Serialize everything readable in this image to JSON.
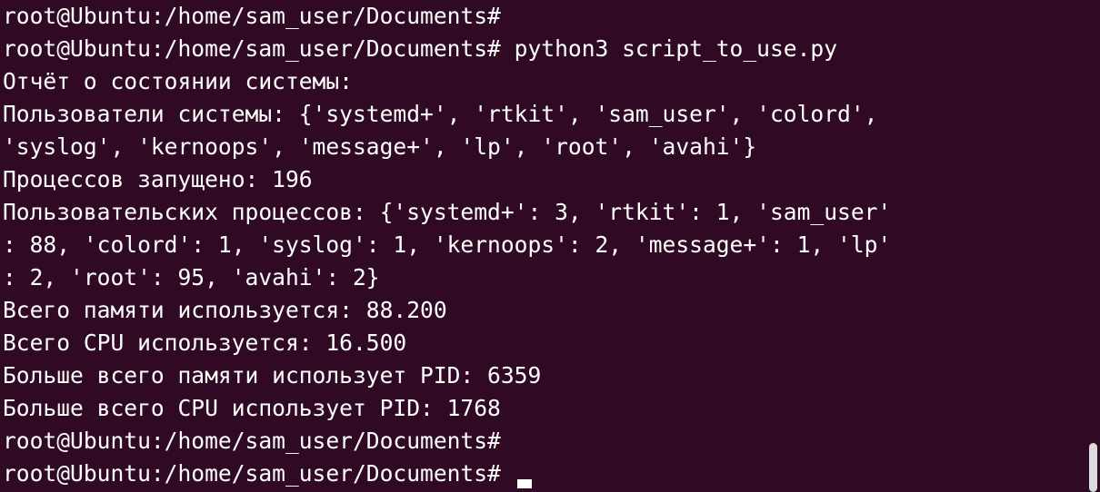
{
  "terminal": {
    "lines": [
      {
        "type": "prompt",
        "text": "root@Ubuntu:/home/sam_user/Documents#"
      },
      {
        "type": "prompt",
        "text": "root@Ubuntu:/home/sam_user/Documents# python3 script_to_use.py"
      },
      {
        "type": "output",
        "text": "Отчёт о состоянии системы:"
      },
      {
        "type": "output",
        "text": "Пользователи системы: {'systemd+', 'rtkit', 'sam_user', 'colord',"
      },
      {
        "type": "output",
        "text": "'syslog', 'kernoops', 'message+', 'lp', 'root', 'avahi'}"
      },
      {
        "type": "output",
        "text": "Процессов запущено: 196"
      },
      {
        "type": "output",
        "text": "Пользовательских процессов: {'systemd+': 3, 'rtkit': 1, 'sam_user'"
      },
      {
        "type": "output",
        "text": ": 88, 'colord': 1, 'syslog': 1, 'kernoops': 2, 'message+': 1, 'lp'"
      },
      {
        "type": "output",
        "text": ": 2, 'root': 95, 'avahi': 2}"
      },
      {
        "type": "output",
        "text": "Всего памяти используется: 88.200"
      },
      {
        "type": "output",
        "text": "Всего CPU используется: 16.500"
      },
      {
        "type": "output",
        "text": "Больше всего памяти использует PID: 6359"
      },
      {
        "type": "output",
        "text": "Больше всего CPU использует PID: 1768"
      },
      {
        "type": "prompt",
        "text": "root@Ubuntu:/home/sam_user/Documents#"
      },
      {
        "type": "prompt",
        "text": "root@Ubuntu:/home/sam_user/Documents#"
      }
    ]
  },
  "colors": {
    "background": "#300a24",
    "foreground": "#ffffff",
    "scrollbar": "#dcdcdc"
  }
}
